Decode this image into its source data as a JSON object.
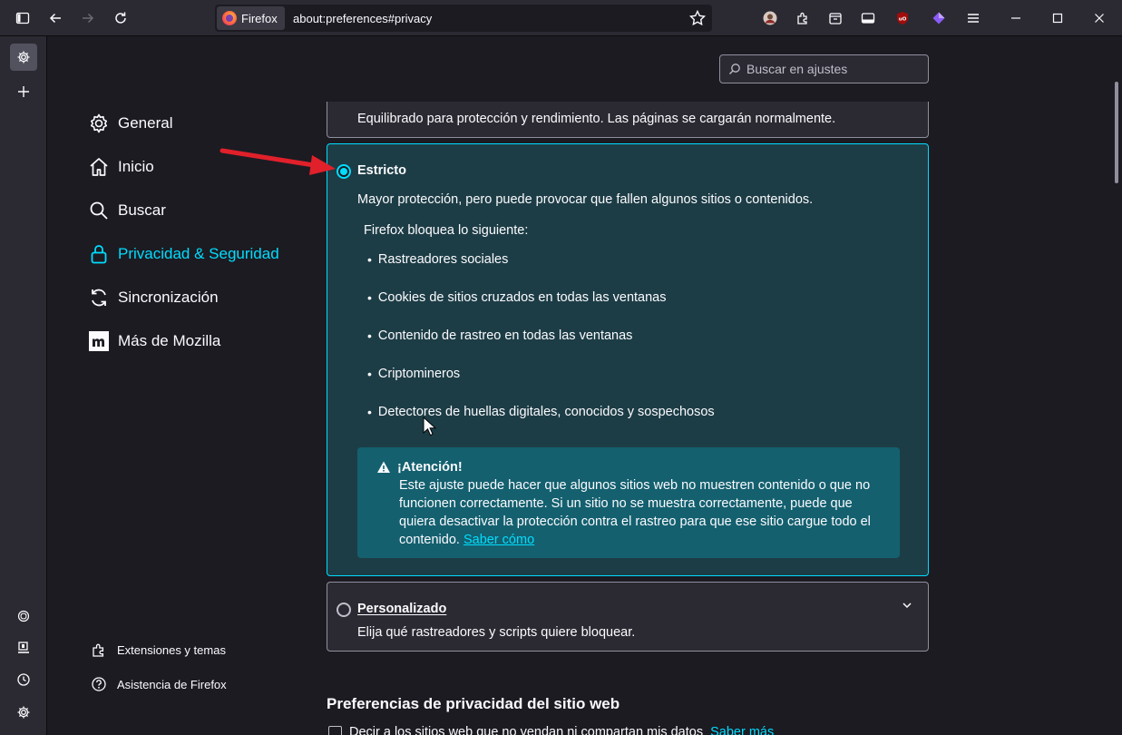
{
  "browser": {
    "identity_label": "Firefox",
    "url": "about:preferences#privacy"
  },
  "search": {
    "placeholder": "Buscar en ajustes"
  },
  "nav": {
    "items": [
      {
        "label": "General"
      },
      {
        "label": "Inicio"
      },
      {
        "label": "Buscar"
      },
      {
        "label": "Privacidad & Seguridad"
      },
      {
        "label": "Sincronización"
      },
      {
        "label": "Más de Mozilla"
      }
    ],
    "footer": [
      {
        "label": "Extensiones y temas"
      },
      {
        "label": "Asistencia de Firefox"
      }
    ]
  },
  "tracking": {
    "standard_desc": "Equilibrado para protección y rendimiento. Las páginas se cargarán normalmente.",
    "strict": {
      "title": "Estricto",
      "desc": "Mayor protección, pero puede provocar que fallen algunos sitios o contenidos.",
      "blocks_heading": "Firefox bloquea lo siguiente:",
      "blocked": [
        "Rastreadores sociales",
        "Cookies de sitios cruzados en todas las ventanas",
        "Contenido de rastreo en todas las ventanas",
        "Criptomineros",
        "Detectores de huellas digitales, conocidos y sospechosos"
      ],
      "warning_title": "¡Atención!",
      "warning_body": "Este ajuste puede hacer que algunos sitios web no muestren contenido o que no funcionen correctamente. Si un sitio no se muestra correctamente, puede que quiera desactivar la protección contra el rastreo para que ese sitio cargue todo el contenido.",
      "warning_link": "Saber cómo"
    },
    "custom": {
      "title": "Personalizado",
      "desc": "Elija qué rastreadores y scripts quiere bloquear."
    }
  },
  "website_prefs": {
    "heading": "Preferencias de privacidad del sitio web",
    "dnt_label": "Decir a los sitios web que no vendan ni compartan mis datos",
    "dnt_link": "Saber más"
  },
  "colors": {
    "accent": "#00ddff",
    "strict_bg": "#1d3d46",
    "warning_bg": "#14606f",
    "annotation_arrow": "#e0202a"
  }
}
